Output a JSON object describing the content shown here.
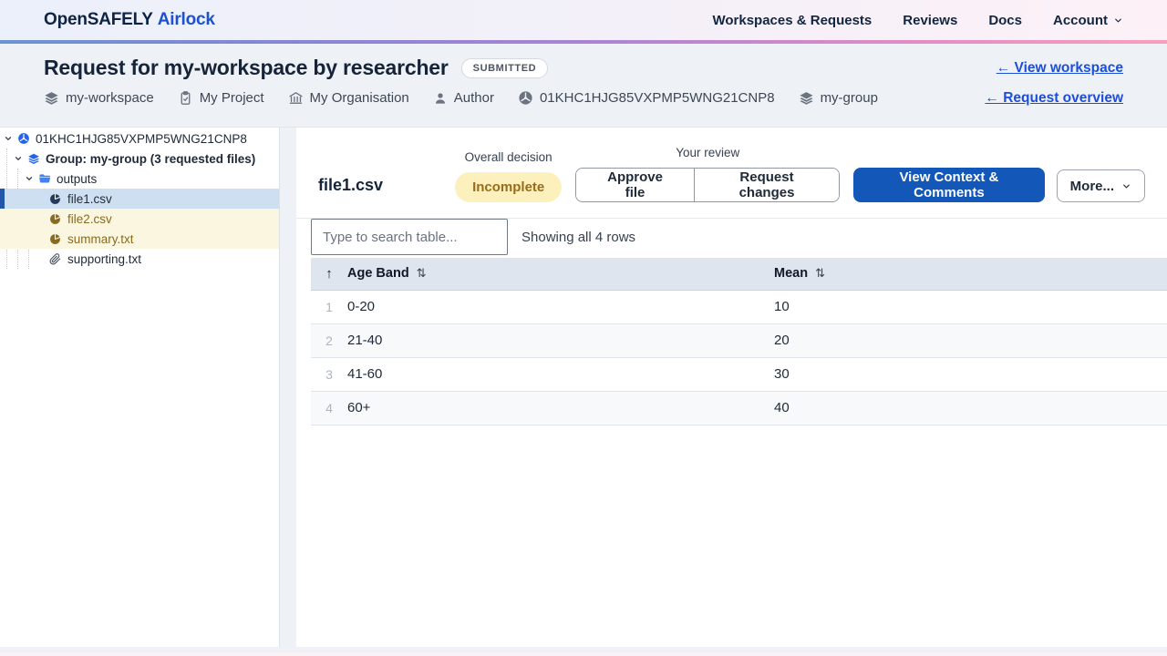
{
  "header": {
    "brand": {
      "name": "OpenSAFELY",
      "product": "Airlock"
    },
    "nav": [
      {
        "label": "Workspaces & Requests"
      },
      {
        "label": "Reviews"
      },
      {
        "label": "Docs"
      },
      {
        "label": "Account"
      }
    ]
  },
  "request_header": {
    "title": "Request for my-workspace by researcher",
    "status_badge": "SUBMITTED",
    "meta": [
      {
        "icon": "layers-icon",
        "label": "my-workspace"
      },
      {
        "icon": "project-icon",
        "label": "My Project"
      },
      {
        "icon": "organisation-icon",
        "label": "My Organisation"
      },
      {
        "icon": "user-icon",
        "label": "Author"
      },
      {
        "icon": "request-id-icon",
        "label": "01KHC1HJG85VXPMP5WNG21CNP8"
      },
      {
        "icon": "layers-icon",
        "label": "my-group"
      }
    ],
    "links": [
      {
        "label": "← View workspace"
      },
      {
        "label": "← Request overview"
      }
    ]
  },
  "file_tree": {
    "root": {
      "label": "01KHC1HJG85VXPMP5WNG21CNP8"
    },
    "group": {
      "label": "Group: my-group (3 requested files)"
    },
    "folder": {
      "label": "outputs"
    },
    "files": [
      {
        "label": "file1.csv",
        "state": "selected"
      },
      {
        "label": "file2.csv",
        "state": "attention"
      },
      {
        "label": "summary.txt",
        "state": "attention"
      },
      {
        "label": "supporting.txt",
        "state": "default"
      }
    ]
  },
  "content": {
    "file_title": "file1.csv",
    "overall_decision": {
      "label": "Overall decision",
      "value": "Incomplete"
    },
    "your_review": {
      "label": "Your review",
      "approve_label": "Approve file",
      "request_changes_label": "Request changes"
    },
    "view_context_label": "View Context & Comments",
    "more_label": "More...",
    "search": {
      "placeholder": "Type to search table...",
      "summary": "Showing all 4 rows"
    }
  },
  "table": {
    "sort_indicator": "↑",
    "sort_glyph": "⇅",
    "columns": [
      "Age Band",
      "Mean"
    ],
    "rows": [
      {
        "index": "1",
        "band": "0-20",
        "mean": "10"
      },
      {
        "index": "2",
        "band": "21-40",
        "mean": "20"
      },
      {
        "index": "3",
        "band": "41-60",
        "mean": "30"
      },
      {
        "index": "4",
        "band": "60+",
        "mean": "40"
      }
    ]
  },
  "colors": {
    "brand_blue": "#1c51d0",
    "primary_button": "#1358b8",
    "selected_file_bg": "#cfdff2",
    "attention_file_bg": "#fbf6df",
    "attention_file_text": "#8a6a1e",
    "incomplete_badge_bg": "#fcf1bc",
    "incomplete_badge_text": "#9a6b1a",
    "table_header_bg": "#dfe5ee"
  }
}
